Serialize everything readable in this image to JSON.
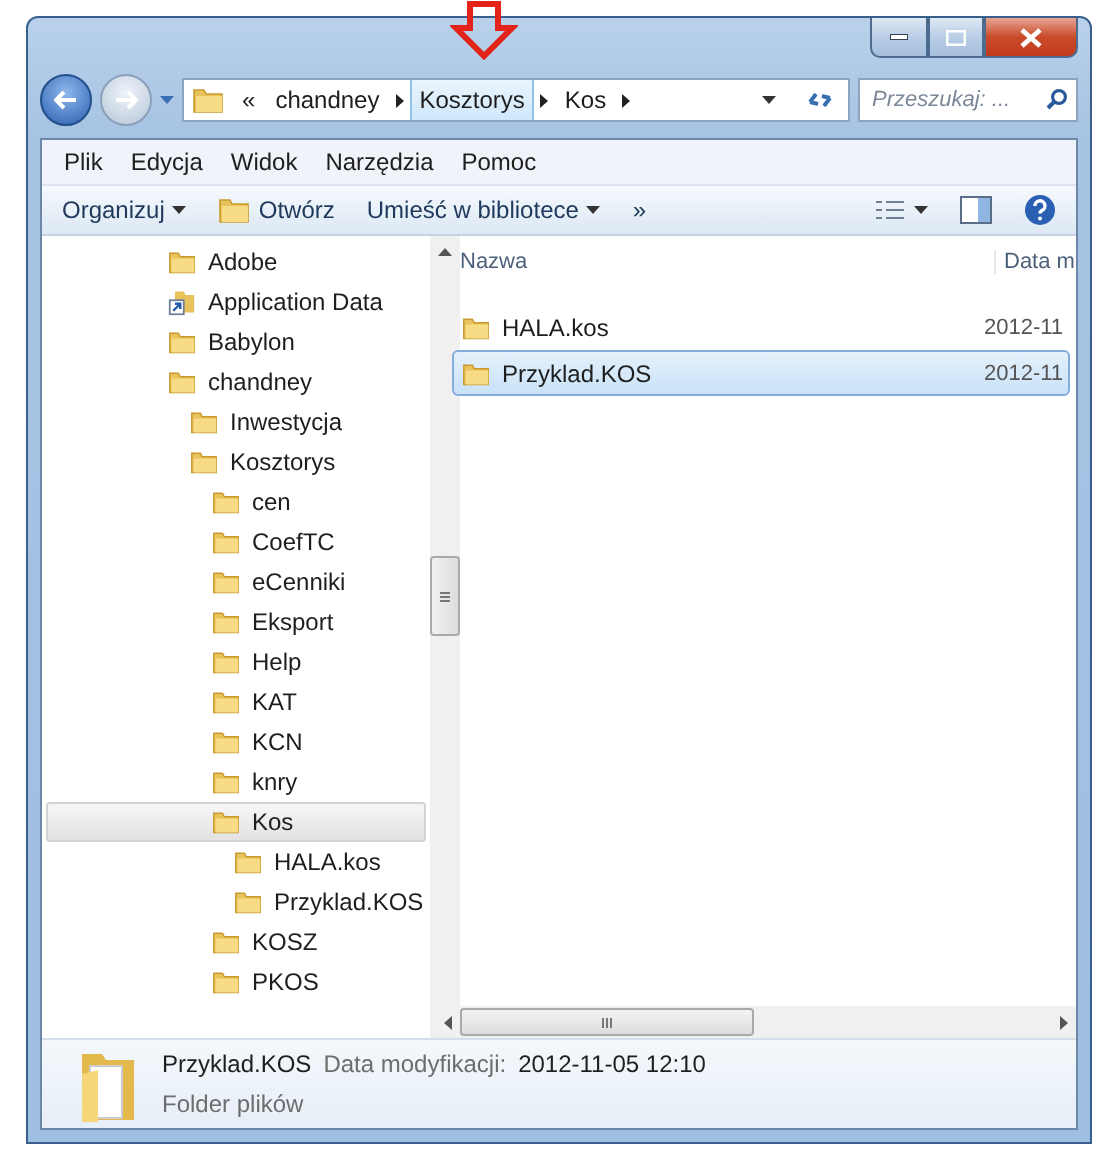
{
  "address_bar": {
    "overflow": "«",
    "crumbs": [
      {
        "label": "chandney",
        "selected": false
      },
      {
        "label": "Kosztorys",
        "selected": true
      },
      {
        "label": "Kos",
        "selected": false
      }
    ]
  },
  "search": {
    "placeholder": "Przeszukaj: ..."
  },
  "menu": [
    "Plik",
    "Edycja",
    "Widok",
    "Narzędzia",
    "Pomoc"
  ],
  "toolbar": [
    {
      "kind": "dropdown",
      "label": "Organizuj"
    },
    {
      "kind": "open",
      "label": "Otwórz"
    },
    {
      "kind": "dropdown",
      "label": "Umieść w bibliotece"
    },
    {
      "kind": "more",
      "label": "»"
    }
  ],
  "tree": [
    {
      "label": "Adobe",
      "kind": "folder",
      "selected": false
    },
    {
      "label": "Application Data",
      "kind": "shortcut",
      "selected": false
    },
    {
      "label": "Babylon",
      "kind": "folder",
      "selected": false
    },
    {
      "label": "chandney",
      "kind": "folder",
      "selected": false,
      "children": [
        {
          "label": "Inwestycja",
          "kind": "folder",
          "selected": false
        },
        {
          "label": "Kosztorys",
          "kind": "folder",
          "selected": false,
          "children": [
            {
              "label": "cen",
              "kind": "folder",
              "selected": false
            },
            {
              "label": "CoefTC",
              "kind": "folder",
              "selected": false
            },
            {
              "label": "eCenniki",
              "kind": "folder",
              "selected": false
            },
            {
              "label": "Eksport",
              "kind": "folder",
              "selected": false
            },
            {
              "label": "Help",
              "kind": "folder",
              "selected": false
            },
            {
              "label": "KAT",
              "kind": "folder",
              "selected": false
            },
            {
              "label": "KCN",
              "kind": "folder",
              "selected": false
            },
            {
              "label": "knry",
              "kind": "folder",
              "selected": false
            },
            {
              "label": "Kos",
              "kind": "folder",
              "selected": true,
              "children": [
                {
                  "label": "HALA.kos",
                  "kind": "folder",
                  "selected": false
                },
                {
                  "label": "Przyklad.KOS",
                  "kind": "folder",
                  "selected": false
                }
              ]
            },
            {
              "label": "KOSZ",
              "kind": "folder",
              "selected": false
            },
            {
              "label": "PKOS",
              "kind": "folder",
              "selected": false
            }
          ]
        }
      ]
    }
  ],
  "file_list": {
    "columns": [
      "Nazwa",
      "Data m"
    ],
    "rows": [
      {
        "name": "HALA.kos",
        "date": "2012-11",
        "selected": false
      },
      {
        "name": "Przyklad.KOS",
        "date": "2012-11",
        "selected": true
      }
    ]
  },
  "details": {
    "name": "Przyklad.KOS",
    "date_label": "Data modyfikacji:",
    "date": "2012-11-05 12:10",
    "type": "Folder plików"
  }
}
